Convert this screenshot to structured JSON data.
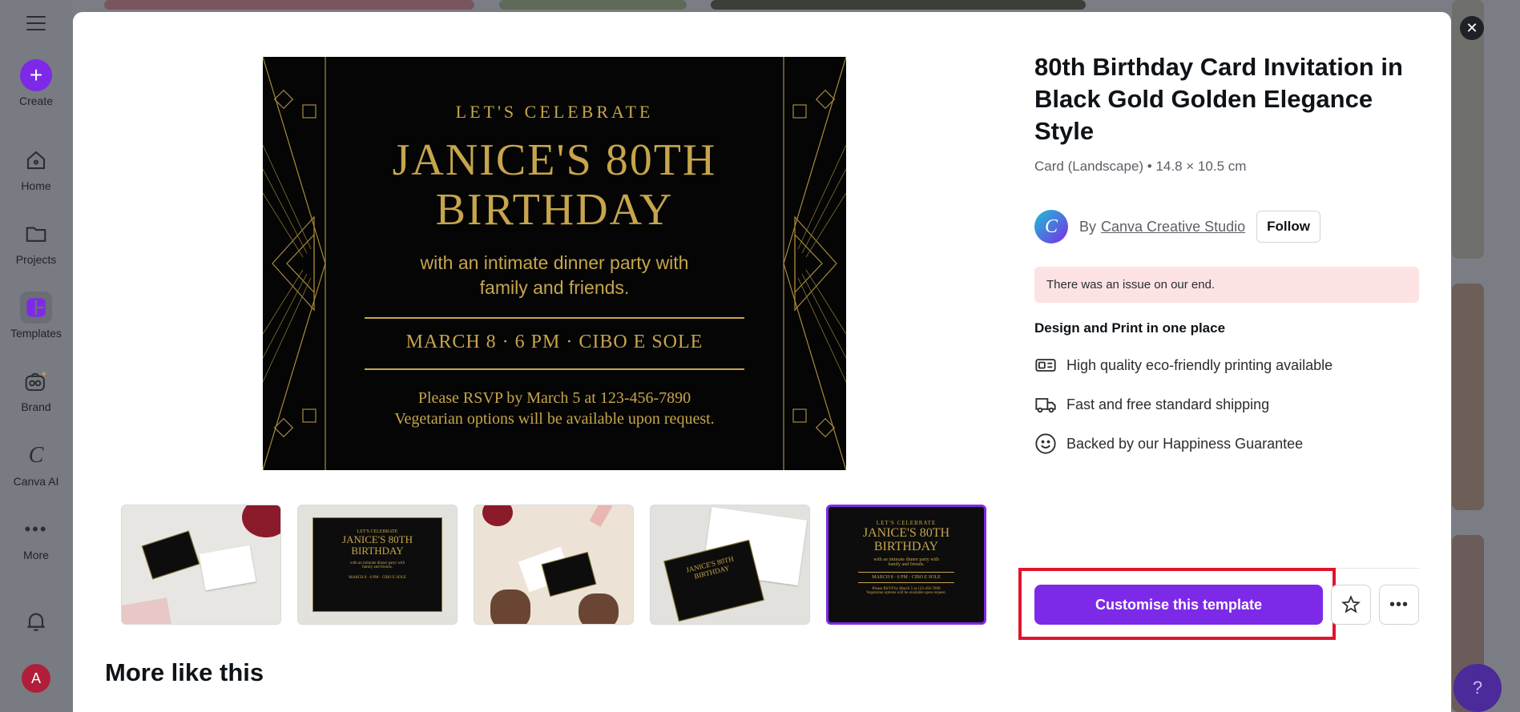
{
  "sidebar": {
    "items": [
      {
        "label": "Create",
        "icon": "plus-icon"
      },
      {
        "label": "Home",
        "icon": "home-icon"
      },
      {
        "label": "Projects",
        "icon": "folder-icon"
      },
      {
        "label": "Templates",
        "icon": "templates-icon"
      },
      {
        "label": "Brand",
        "icon": "brand-icon"
      },
      {
        "label": "Canva AI",
        "icon": "canva-ai-icon"
      },
      {
        "label": "More",
        "icon": "more-dots-icon"
      }
    ],
    "avatar_initial": "A"
  },
  "modal": {
    "preview": {
      "kicker": "LET'S CELEBRATE",
      "title_line1": "JANICE'S 80TH",
      "title_line2": "BIRTHDAY",
      "sub_line1": "with an intimate dinner party with",
      "sub_line2": "family and friends.",
      "date_line": "MARCH 8 · 6 PM · CIBO E SOLE",
      "rsvp_line1": "Please RSVP by March 5 at 123-456-7890",
      "rsvp_line2": "Vegetarian options will be available upon request."
    },
    "thumbnails_selected_index": 4,
    "title": "80th Birthday Card Invitation in Black Gold Golden Elegance Style",
    "meta": "Card (Landscape) • 14.8 × 10.5 cm",
    "author": {
      "by": "By",
      "name": "Canva Creative Studio",
      "follow_label": "Follow"
    },
    "alert": "There was an issue on our end.",
    "section_heading": "Design and Print in one place",
    "features": [
      {
        "icon": "print-icon",
        "text": "High quality eco-friendly printing available"
      },
      {
        "icon": "truck-icon",
        "text": "Fast and free standard shipping"
      },
      {
        "icon": "smiley-icon",
        "text": "Backed by our Happiness Guarantee"
      }
    ],
    "cta_label": "Customise this template",
    "more_like_this": "More like this"
  },
  "help_label": "?",
  "colors": {
    "accent": "#7d2ae8",
    "gold": "#c6a54c",
    "alert_bg": "#fde2e4",
    "highlight": "#e0142d"
  }
}
